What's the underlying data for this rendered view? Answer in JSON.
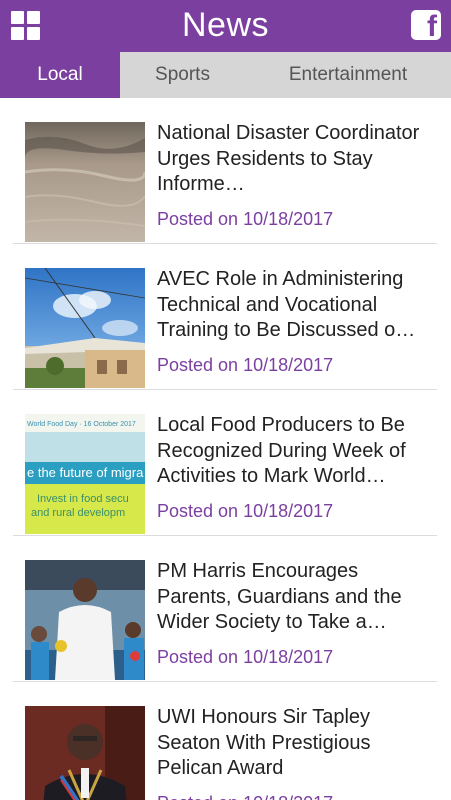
{
  "app": {
    "title": "News",
    "accent": "#7b3fa0"
  },
  "header": {
    "menu_icon": "grid-icon",
    "share_icon": "facebook-icon",
    "facebook_glyph": "f"
  },
  "tabs": [
    {
      "label": "Local",
      "active": true
    },
    {
      "label": "Sports",
      "active": false
    },
    {
      "label": "Entertainment",
      "active": false
    }
  ],
  "articles": [
    {
      "title": "National Disaster Coordinator Urges Residents to Stay Informe…",
      "date": "Posted on 10/18/2017",
      "thumb": "flooded-sand-photo"
    },
    {
      "title": "AVEC Role in Administering Technical and Vocational Training to Be Discussed o…",
      "date": "Posted on 10/18/2017",
      "thumb": "building-sky-photo"
    },
    {
      "title": "Local Food Producers to Be Recognized During Week of Activities to Mark World…",
      "date": "Posted on 10/18/2017",
      "thumb": "world-food-day-banner",
      "thumb_text": {
        "top": "World Food Day · 16 October 2017",
        "band": "e the future of migra",
        "line1": "Invest in food secu",
        "line2": "and rural developm"
      }
    },
    {
      "title": "PM Harris Encourages Parents, Guardians and the Wider Society to Take a…",
      "date": "Posted on 10/18/2017",
      "thumb": "pm-with-children-photo"
    },
    {
      "title": "UWI Honours Sir Tapley Seaton With Prestigious Pelican Award",
      "date": "Posted on 10/18/2017",
      "thumb": "honoree-portrait-photo"
    }
  ]
}
